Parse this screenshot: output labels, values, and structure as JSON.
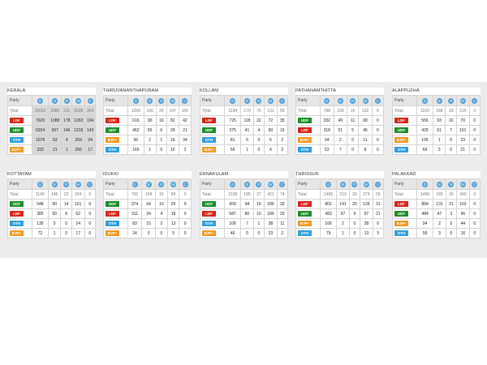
{
  "header_cols": [
    "G",
    "B",
    "R",
    "W",
    "C"
  ],
  "party_header": "Party",
  "total_label": "Total",
  "colors": {
    "LDF": "#d7261b",
    "UDF": "#1e8e2d",
    "OTH": "#2f9fe0",
    "BJP+": "#f39a22"
  },
  "cards": [
    {
      "title": "KERALA",
      "total": [
        "15062",
        "2080",
        "211",
        "3028",
        "354"
      ],
      "rows": [
        [
          "LDF",
          "7620",
          "1088",
          "178",
          "1263",
          "194"
        ],
        [
          "UDF",
          "6324",
          "657",
          "146",
          "1319",
          "143"
        ],
        [
          "OTH",
          "1078",
          "53",
          "4",
          "259",
          "24"
        ],
        [
          "BJP+",
          "333",
          "21",
          "1",
          "206",
          "17"
        ]
      ]
    },
    {
      "title": "THIRUVANANTHAPURAM",
      "total": [
        "1299",
        "166",
        "25",
        "147",
        "100"
      ],
      "rows": [
        [
          "LDF",
          "616",
          "90",
          "19",
          "82",
          "42"
        ],
        [
          "UDF",
          "462",
          "60",
          "6",
          "29",
          "21"
        ],
        [
          "BJP+",
          "56",
          "2",
          "1",
          "16",
          "34"
        ],
        [
          "OTH",
          "165",
          "1",
          "0",
          "10",
          "3"
        ]
      ]
    },
    {
      "title": "KOLLAM",
      "total": [
        "1234",
        "170",
        "76",
        "131",
        "55"
      ],
      "rows": [
        [
          "LDF",
          "725",
          "118",
          "22",
          "72",
          "35"
        ],
        [
          "UDF",
          "375",
          "41",
          "4",
          "50",
          "16"
        ],
        [
          "OTH",
          "81",
          "0",
          "0",
          "5",
          "2"
        ],
        [
          "BJP+",
          "55",
          "1",
          "0",
          "4",
          "2"
        ]
      ]
    },
    {
      "title": "PATHANAMTHITTA",
      "total": [
        "788",
        "106",
        "16",
        "132",
        "0"
      ],
      "rows": [
        [
          "UDF",
          "332",
          "49",
          "11",
          "68",
          "0"
        ],
        [
          "LDF",
          "318",
          "51",
          "5",
          "45",
          "0"
        ],
        [
          "BJP+",
          "94",
          "2",
          "0",
          "11",
          "0"
        ],
        [
          "OTH",
          "53",
          "7",
          "0",
          "8",
          "0"
        ]
      ]
    },
    {
      "title": "ALAPPUZHA",
      "total": [
        "1169",
        "158",
        "23",
        "215",
        "0"
      ],
      "rows": [
        [
          "LDF",
          "566",
          "93",
          "16",
          "70",
          "0"
        ],
        [
          "UDF",
          "429",
          "61",
          "7",
          "101",
          "0"
        ],
        [
          "BJP+",
          "105",
          "1",
          "0",
          "23",
          "0"
        ],
        [
          "OTH",
          "69",
          "3",
          "0",
          "21",
          "0"
        ]
      ]
    },
    {
      "title": "KOTTAYAM",
      "total": [
        "1140",
        "146",
        "22",
        "204",
        "0"
      ],
      "rows": [
        [
          "UDF",
          "548",
          "90",
          "14",
          "101",
          "0"
        ],
        [
          "LDF",
          "385",
          "50",
          "8",
          "62",
          "0"
        ],
        [
          "OTH",
          "135",
          "5",
          "0",
          "24",
          "0"
        ],
        [
          "BJP+",
          "72",
          "1",
          "0",
          "17",
          "0"
        ]
      ]
    },
    {
      "title": "IDUKKI",
      "total": [
        "792",
        "104",
        "16",
        "69",
        "0"
      ],
      "rows": [
        [
          "UDF",
          "374",
          "64",
          "10",
          "29",
          "0"
        ],
        [
          "LDF",
          "311",
          "24",
          "4",
          "18",
          "0"
        ],
        [
          "OTH",
          "83",
          "15",
          "2",
          "13",
          "0"
        ],
        [
          "BJP+",
          "24",
          "0",
          "0",
          "9",
          "0"
        ]
      ]
    },
    {
      "title": "ERNAKULAM",
      "total": [
        "1338",
        "185",
        "27",
        "421",
        "74"
      ],
      "rows": [
        [
          "UDF",
          "609",
          "94",
          "16",
          "180",
          "33"
        ],
        [
          "LDF",
          "587",
          "80",
          "10",
          "180",
          "33"
        ],
        [
          "OTH",
          "106",
          "7",
          "1",
          "38",
          "11"
        ],
        [
          "BJP+",
          "46",
          "0",
          "0",
          "23",
          "2"
        ]
      ]
    },
    {
      "title": "THRISSUR",
      "total": [
        "1465",
        "213",
        "29",
        "274",
        "55"
      ],
      "rows": [
        [
          "LDF",
          "801",
          "141",
          "20",
          "126",
          "31"
        ],
        [
          "UDF",
          "483",
          "67",
          "9",
          "97",
          "21"
        ],
        [
          "BJP+",
          "106",
          "2",
          "0",
          "28",
          "6"
        ],
        [
          "OTH",
          "79",
          "1",
          "0",
          "13",
          "5"
        ]
      ]
    },
    {
      "title": "PALAKKAD",
      "total": [
        "1490",
        "183",
        "30",
        "340",
        "0"
      ],
      "rows": [
        [
          "LDF",
          "864",
          "131",
          "21",
          "163",
          "0"
        ],
        [
          "UDF",
          "484",
          "47",
          "3",
          "96",
          "0"
        ],
        [
          "BJP+",
          "94",
          "2",
          "0",
          "44",
          "0"
        ],
        [
          "OTH",
          "55",
          "3",
          "0",
          "16",
          "0"
        ]
      ]
    }
  ]
}
